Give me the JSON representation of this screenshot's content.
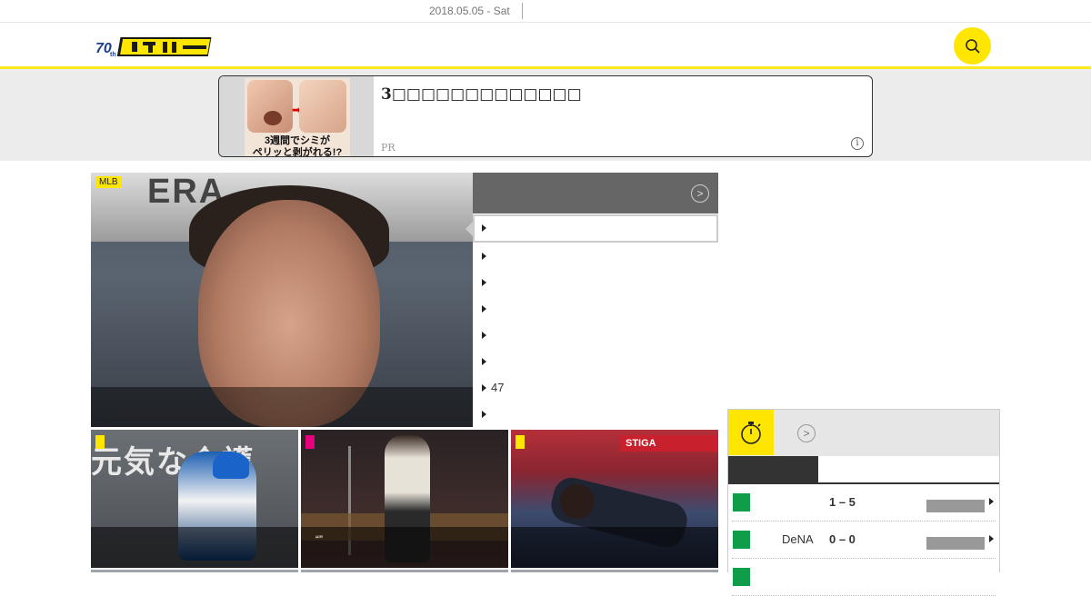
{
  "topbar": {
    "date": "2018.05.05 - Sat"
  },
  "header": {
    "logo_icon": "daily-sports-logo",
    "search_icon": "search-icon",
    "accent": "#ffe600"
  },
  "ad": {
    "headline": "3",
    "image_caption_1": "3週間でシミが",
    "image_caption_2": "ペリッと剥がれる!?",
    "pr_label": "PR",
    "info_label": "i"
  },
  "hero": {
    "tag": "MLB",
    "hero_banner_text": "ERA"
  },
  "ranking": {
    "more_label": ">",
    "items": [
      "",
      "",
      "",
      "",
      "",
      "",
      "47",
      ""
    ]
  },
  "thumbs": [
    {
      "tag_color": "#ffe600",
      "sign_text": "元気な介護"
    },
    {
      "tag_color": "#e6007e",
      "caption": "“”"
    },
    {
      "tag_color": "#ffe600",
      "board_text": "STIGA"
    }
  ],
  "scoreboard": {
    "icon": "stopwatch-icon",
    "more_label": ">",
    "games": [
      {
        "team": "",
        "score": "1 – 5"
      },
      {
        "team": "DeNA",
        "score": "0 – 0"
      }
    ]
  }
}
